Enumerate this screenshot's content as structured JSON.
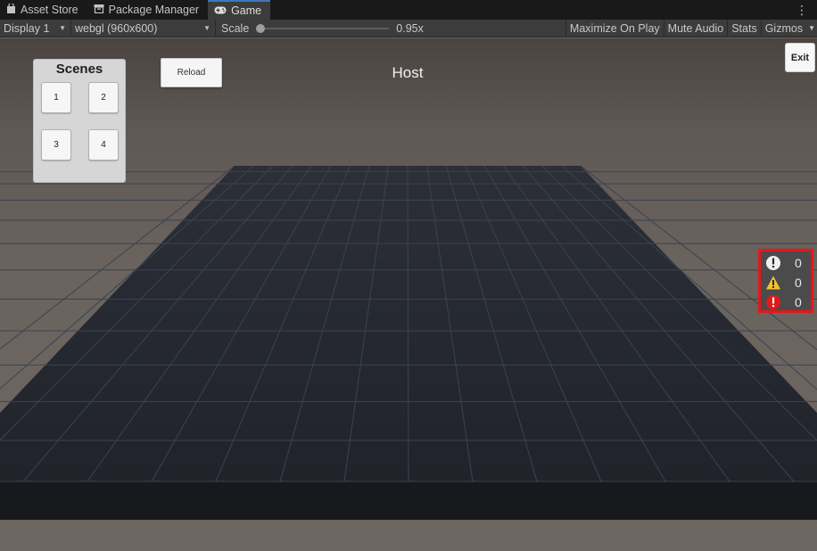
{
  "tabs": [
    {
      "label": "Asset Store",
      "icon": "shopping-bag-icon",
      "active": false
    },
    {
      "label": "Package Manager",
      "icon": "package-icon",
      "active": false
    },
    {
      "label": "Game",
      "icon": "gamepad-icon",
      "active": true
    }
  ],
  "toolbar": {
    "display": "Display 1",
    "resolution": "webgl (960x600)",
    "scale_label": "Scale",
    "scale_value": "0.95x",
    "maximize": "Maximize On Play",
    "mute": "Mute Audio",
    "stats": "Stats",
    "gizmos": "Gizmos"
  },
  "game": {
    "scenes": {
      "title": "Scenes",
      "buttons": [
        "1",
        "2",
        "3",
        "4"
      ]
    },
    "reload": "Reload",
    "host": "Host",
    "exit": "Exit",
    "console": {
      "info_count": "0",
      "warning_count": "0",
      "error_count": "0"
    }
  },
  "colors": {
    "accent_tab": "#3a79bb",
    "console_border": "#e0191d",
    "floor": "#22252d"
  }
}
